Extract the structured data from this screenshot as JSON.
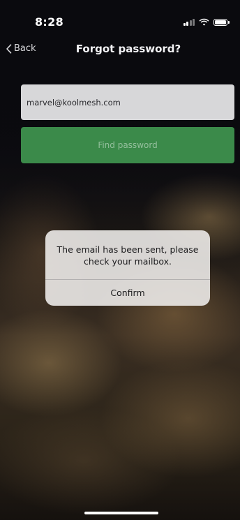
{
  "status_bar": {
    "time": "8:28",
    "icons": [
      "cellular-signal-icon",
      "wifi-icon",
      "battery-icon"
    ]
  },
  "nav": {
    "back_label": "Back",
    "back_icon": "chevron-left-icon",
    "title": "Forgot password?"
  },
  "form": {
    "email_value": "marvel@koolmesh.com",
    "find_button_label": "Find password",
    "find_button_color": "#3b8a4a"
  },
  "alert": {
    "message": "The email has been sent, please check your mailbox.",
    "confirm_label": "Confirm"
  }
}
